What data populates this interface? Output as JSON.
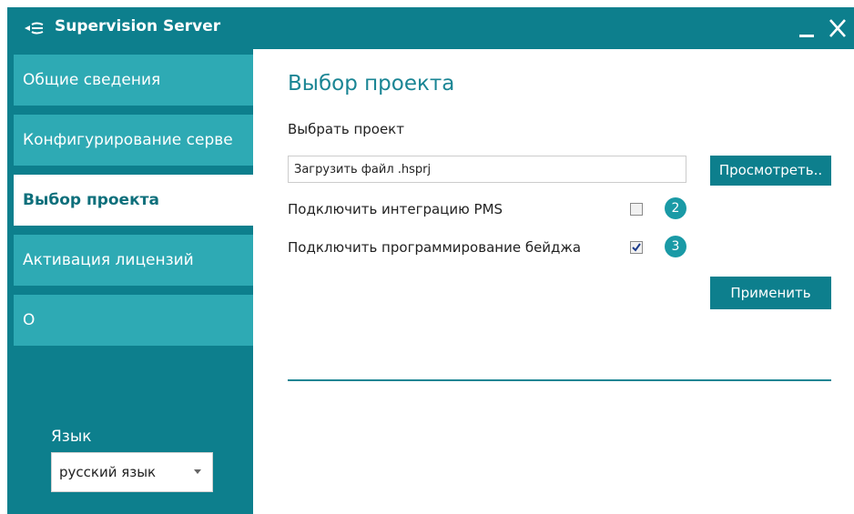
{
  "window": {
    "title": "Supervision Server"
  },
  "titlebar": {
    "minimize": "_",
    "close": "✕"
  },
  "sidebar": {
    "items": [
      {
        "label": "Общие сведения",
        "active": false
      },
      {
        "label": "Конфигурирование серве",
        "active": false
      },
      {
        "label": "Выбор проекта",
        "active": true
      },
      {
        "label": "Активация лицензий",
        "active": false
      },
      {
        "label": "О",
        "active": false
      }
    ],
    "language_label": "Язык",
    "language_value": "русский язык"
  },
  "main": {
    "title": "Выбор проекта",
    "select_label": "Выбрать проект",
    "file_input_value": "Загрузить файл .hsprj",
    "browse_label": "Просмотреть..",
    "options": [
      {
        "label": "Подключить интеграцию PMS",
        "checked": false,
        "badge": "2"
      },
      {
        "label": "Подключить программирование бейджа",
        "checked": true,
        "badge": "3"
      }
    ],
    "apply_label": "Применить"
  },
  "colors": {
    "accent": "#0d7f8d",
    "sidebar_item": "#2eaab4",
    "badge": "#1a9aa6"
  }
}
